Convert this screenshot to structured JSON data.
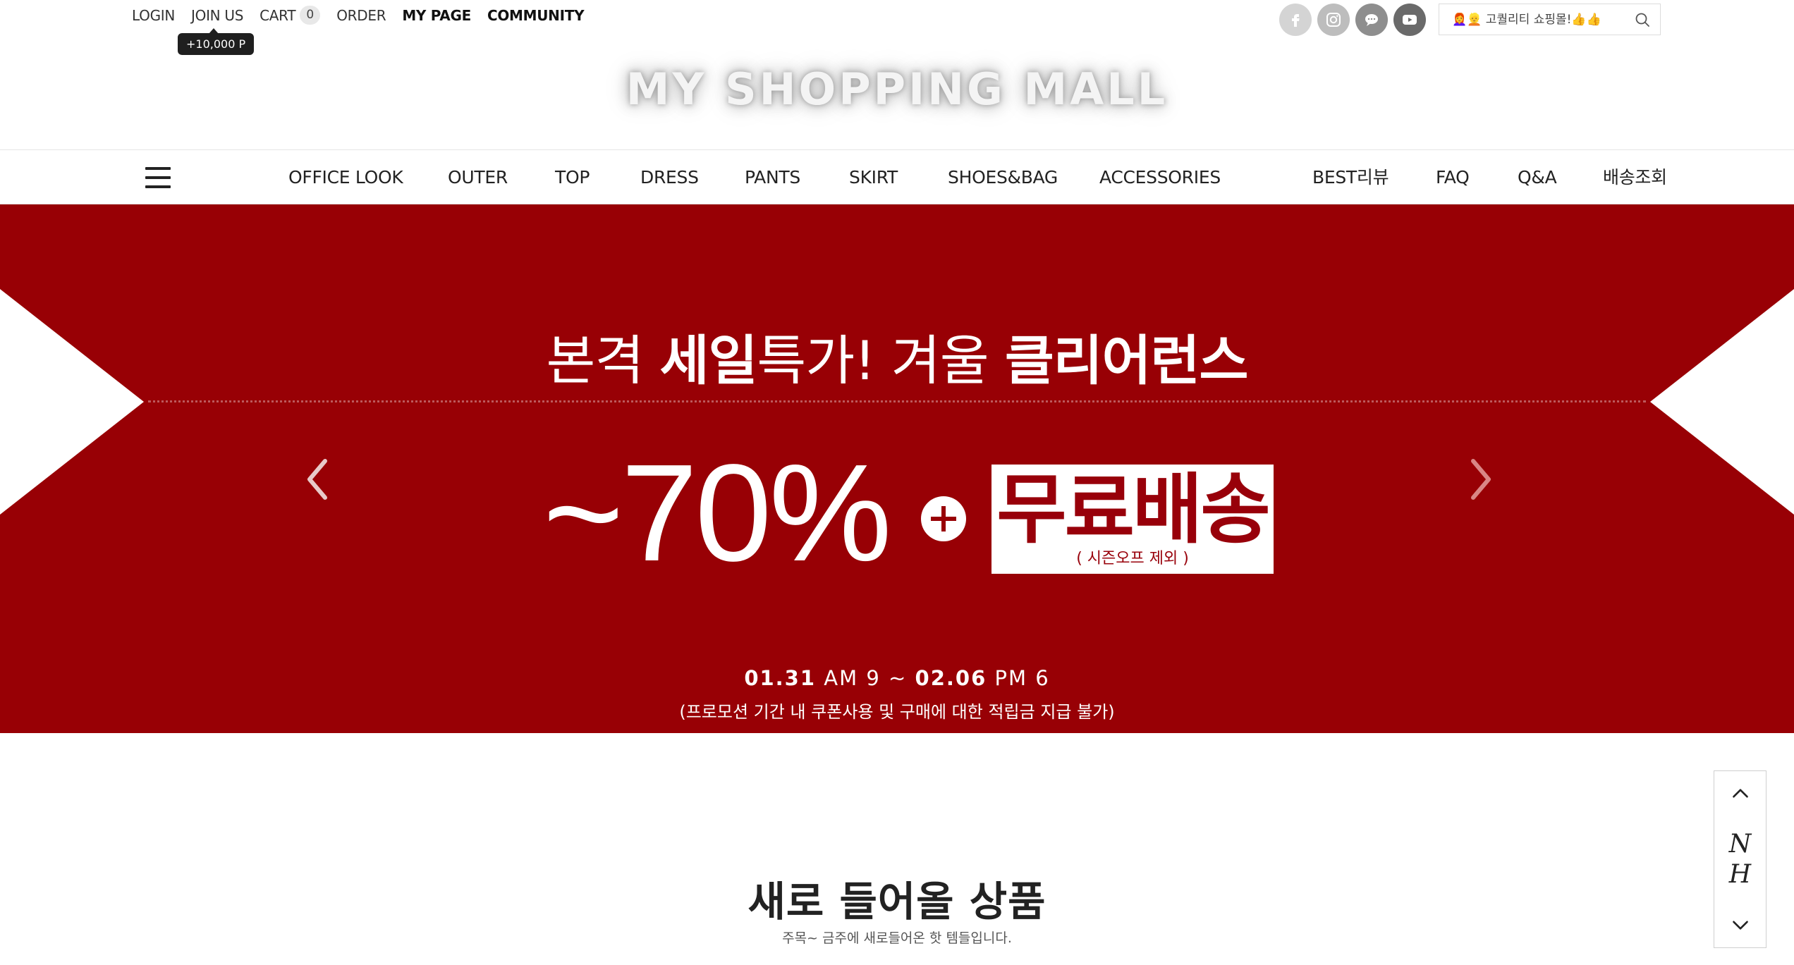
{
  "topnav": {
    "login": "LOGIN",
    "join": "JOIN US",
    "cart": "CART",
    "cart_count": "0",
    "order": "ORDER",
    "mypage": "MY PAGE",
    "community": "COMMUNITY",
    "points_tooltip": "+10,000 P"
  },
  "social": {
    "icons": [
      "facebook-icon",
      "instagram-icon",
      "chat-icon",
      "youtube-icon"
    ],
    "colors": [
      "#d4d4d4",
      "#bdbdbd",
      "#8e8e8e",
      "#6a6a6a"
    ]
  },
  "search": {
    "placeholder": "👩‍🦰👱 고퀄리티 쇼핑몰!👍👍"
  },
  "logo": {
    "text": "MY SHOPPING MALL"
  },
  "mainnav": {
    "categories": [
      "OFFICE LOOK",
      "OUTER",
      "TOP",
      "DRESS",
      "PANTS",
      "SKIRT",
      "SHOES&BAG",
      "ACCESSORIES"
    ],
    "extras": [
      "BEST리뷰",
      "FAQ",
      "Q&A",
      "배송조회"
    ]
  },
  "banner": {
    "bg_color": "#980005",
    "headline_a": "본격 ",
    "headline_b": "세일",
    "headline_c": "특가! 겨울 ",
    "headline_d": "클리어런스",
    "discount": "~70%",
    "free_shipping": "무료배송",
    "free_shipping_note": "( 시즌오프 제외 )",
    "date_start": "01.31",
    "time_start": " AM 9 ~ ",
    "date_end": "02.06",
    "time_end": " PM 6",
    "notice": "(프로모션 기간 내 쿠폰사용 및 구매에 대한 적립금 지급 불가)"
  },
  "section": {
    "title": "새로 들어올 상품",
    "subtitle": "주목~ 금주에 새로들어온 핫 템들입니다."
  },
  "floatbox": {
    "letter1": "N",
    "letter2": "H"
  }
}
